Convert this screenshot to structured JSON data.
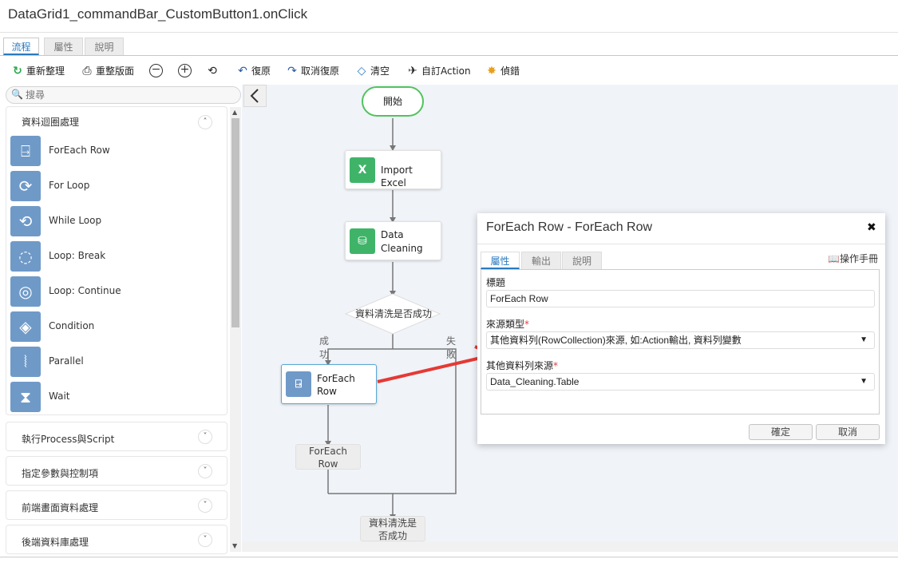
{
  "window": {
    "title": "DataGrid1_commandBar_CustomButton1.onClick"
  },
  "tabs": [
    {
      "label": "流程"
    },
    {
      "label": "屬性"
    },
    {
      "label": "說明"
    }
  ],
  "toolbar": {
    "rearrange": "重新整理",
    "reformat": "重整版面",
    "zoom_out": "−",
    "zoom_in": "+",
    "undo": "復原",
    "redo": "取消復原",
    "clear": "清空",
    "custom_action": "自訂Action",
    "debug": "偵錯"
  },
  "sidebar": {
    "search_placeholder": "搜尋",
    "open_category": "資料迴圈處理",
    "items": [
      {
        "label": "ForEach Row",
        "icon": "foreach-row-icon"
      },
      {
        "label": "For Loop",
        "icon": "for-loop-icon"
      },
      {
        "label": "While Loop",
        "icon": "while-loop-icon"
      },
      {
        "label": "Loop: Break",
        "icon": "loop-break-icon"
      },
      {
        "label": "Loop: Continue",
        "icon": "loop-continue-icon"
      },
      {
        "label": "Condition",
        "icon": "condition-icon"
      },
      {
        "label": "Parallel",
        "icon": "parallel-icon"
      },
      {
        "label": "Wait",
        "icon": "wait-icon"
      }
    ],
    "categories": [
      {
        "label": "執行Process與Script"
      },
      {
        "label": "指定參數與控制項"
      },
      {
        "label": "前端畫面資料處理"
      },
      {
        "label": "後端資料庫處理"
      }
    ]
  },
  "flow": {
    "start": "開始",
    "import_excel": "Import Excel",
    "data_cleaning_1": "Data",
    "data_cleaning_2": "Cleaning",
    "decision": "資料清洗是否成功",
    "success": "成功",
    "fail": "失敗",
    "foreach_1": "ForEach",
    "foreach_2": "Row",
    "foreach_end_1": "ForEach",
    "foreach_end_2": "Row",
    "merge_1": "資料清洗是",
    "merge_2": "否成功"
  },
  "dialog": {
    "title": "ForEach Row - ForEach Row",
    "tabs": [
      {
        "label": "屬性"
      },
      {
        "label": "輸出"
      },
      {
        "label": "說明"
      }
    ],
    "manual": "操作手冊",
    "title_label": "標題",
    "title_value": "ForEach Row",
    "source_type_label": "來源類型",
    "source_type_value": "其他資料列(RowCollection)來源, 如:Action輸出, 資料列變數",
    "other_source_label": "其他資料列來源",
    "other_source_value": "Data_Cleaning.Table",
    "ok": "確定",
    "cancel": "取消",
    "required_mark": "*"
  },
  "colors": {
    "accent": "#2a7ac0",
    "start_border": "#52c35e",
    "node_icon": "#3fb469",
    "palette_icon": "#6f9ac8",
    "annotation_arrow": "#e53935"
  }
}
